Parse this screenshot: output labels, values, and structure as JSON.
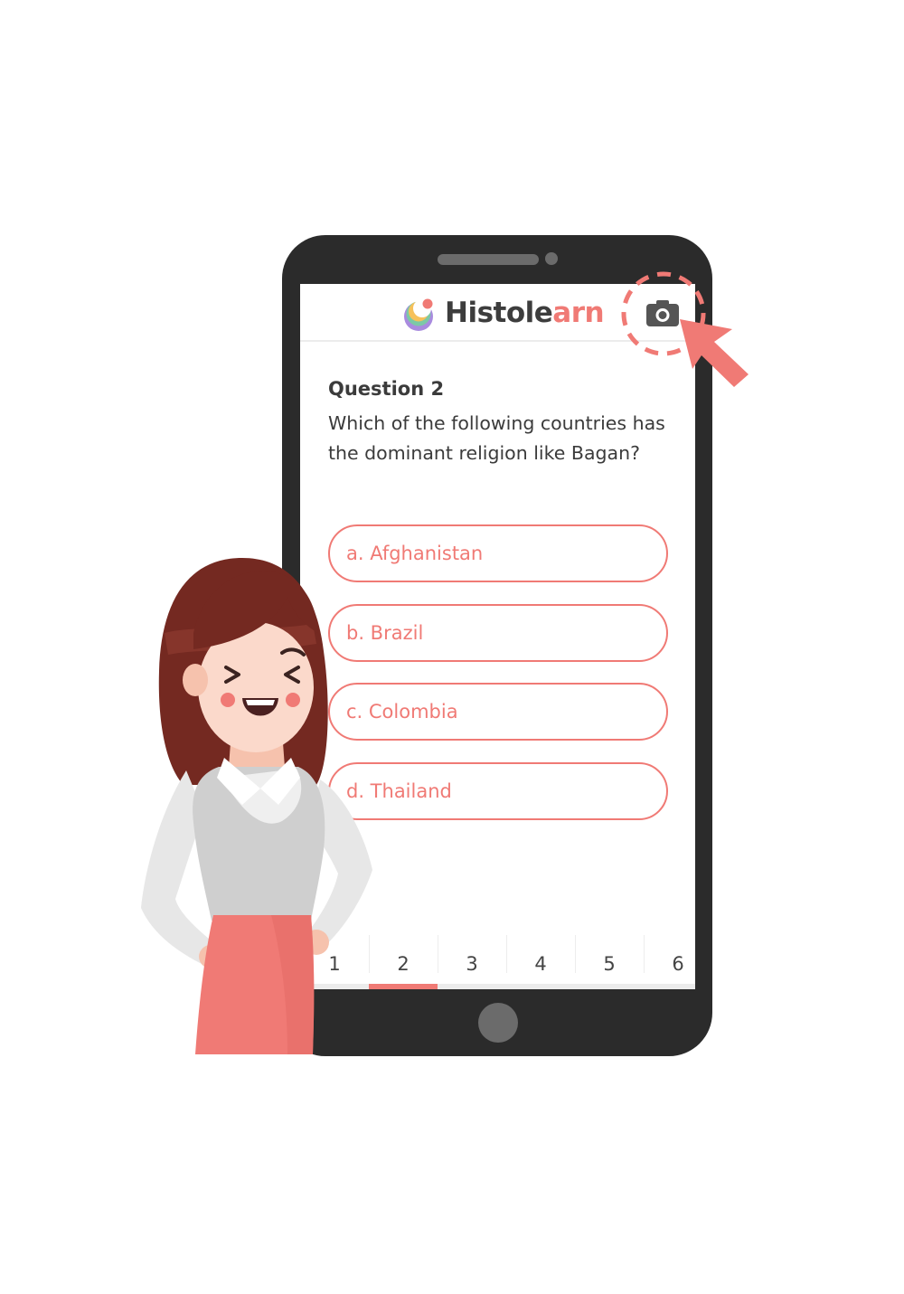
{
  "app": {
    "brand_main": "Histole",
    "brand_accent": "arn",
    "camera_icon": "camera-icon"
  },
  "question": {
    "title": "Question 2",
    "text": "Which of the following countries has the dominant religion like Bagan?"
  },
  "options": [
    {
      "label": "a. Afghanistan"
    },
    {
      "label": "b. Brazil"
    },
    {
      "label": "c. Colombia"
    },
    {
      "label": "d. Thailand"
    }
  ],
  "pager": {
    "pages": [
      "1",
      "2",
      "3",
      "4",
      "5",
      "6"
    ],
    "current": "2"
  },
  "colors": {
    "accent": "#f07a75",
    "phone_body": "#2b2b2b",
    "text": "#3b3b3b"
  }
}
